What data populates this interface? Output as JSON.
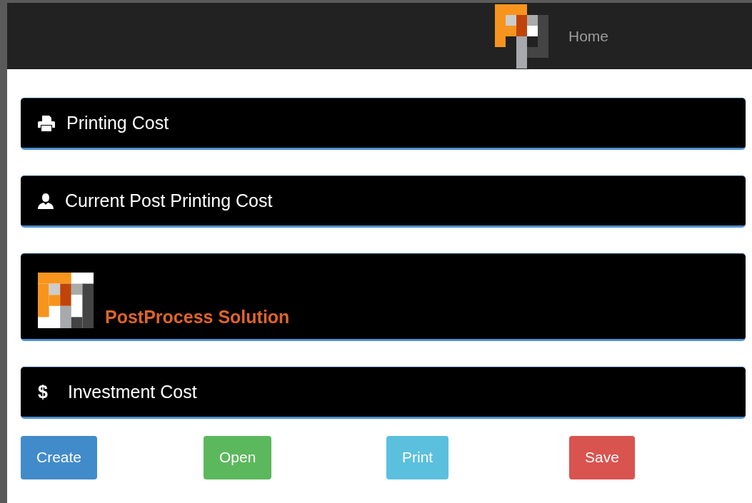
{
  "navbar": {
    "home_link": "Home"
  },
  "panels": [
    {
      "kind": "heading",
      "title": "Printing Cost"
    },
    {
      "kind": "heading",
      "title": "Current Post Printing Cost"
    },
    {
      "kind": "brand",
      "title": "PostProcess Solution"
    },
    {
      "kind": "heading",
      "symbol": "$",
      "title": "Investment Cost"
    }
  ],
  "buttons": [
    {
      "label": "Create",
      "color": "#428bca"
    },
    {
      "label": "Open",
      "color": "#5cb85c"
    },
    {
      "label": "Print",
      "color": "#5bc0de"
    },
    {
      "label": "Save",
      "color": "#d9534f"
    }
  ]
}
